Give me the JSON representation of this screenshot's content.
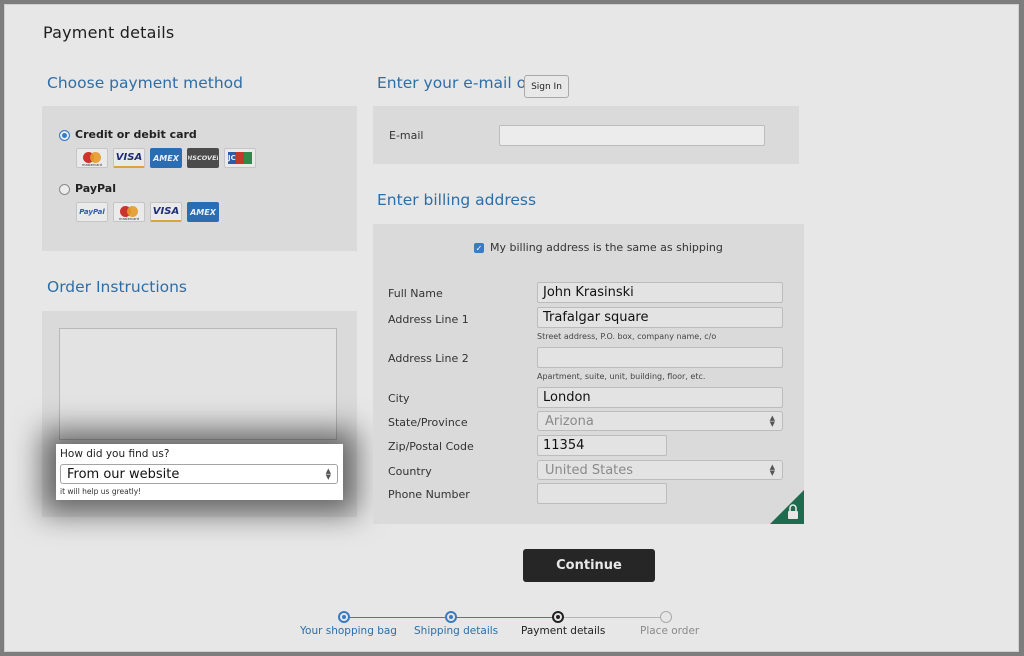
{
  "page": {
    "title": "Payment details"
  },
  "payment_method": {
    "heading": "Choose payment method",
    "options": [
      {
        "label": "Credit or debit card",
        "selected": true,
        "cards": [
          "mastercard",
          "VISA",
          "AMEX",
          "DISCOVER",
          "JCB"
        ]
      },
      {
        "label": "PayPal",
        "selected": false,
        "cards": [
          "PayPal",
          "mastercard",
          "VISA",
          "AMEX"
        ]
      }
    ],
    "mastercard_text": "mastercard",
    "visa_text": "VISA",
    "amex_text": "AMEX",
    "discover_text": "DISCOVER",
    "jcb_text": "JCB",
    "paypal_text": "PayPal"
  },
  "email": {
    "heading": "Enter your e-mail or",
    "sign_in": "Sign In",
    "label": "E-mail",
    "value": ""
  },
  "billing": {
    "heading": "Enter billing address",
    "same_as_shipping": "My billing address is the same as shipping",
    "same_checked": true,
    "fields": {
      "full_name": {
        "label": "Full Name",
        "value": "John Krasinski"
      },
      "address1": {
        "label": "Address Line 1",
        "value": "Trafalgar square",
        "hint": "Street address, P.O. box, company name, c/o"
      },
      "address2": {
        "label": "Address Line 2",
        "value": "",
        "hint": "Apartment, suite, unit, building, floor, etc."
      },
      "city": {
        "label": "City",
        "value": "London"
      },
      "state": {
        "label": "State/Province",
        "value": "Arizona"
      },
      "zip": {
        "label": "Zip/Postal Code",
        "value": "11354"
      },
      "country": {
        "label": "Country",
        "value": "United States"
      },
      "phone": {
        "label": "Phone Number",
        "value": ""
      }
    }
  },
  "order_instructions": {
    "heading": "Order Instructions",
    "value": ""
  },
  "survey": {
    "question": "How did you find us?",
    "selected": "From our website",
    "note": "it will help us greatly!"
  },
  "continue_label": "Continue",
  "steps": [
    {
      "label": "Your shopping bag",
      "state": "done"
    },
    {
      "label": "Shipping details",
      "state": "done"
    },
    {
      "label": "Payment details",
      "state": "current"
    },
    {
      "label": "Place order",
      "state": "upcoming"
    }
  ],
  "colors": {
    "accent": "#2e6ea7",
    "badge": "#1f6b4f"
  },
  "icons": {
    "lock": "lock-icon"
  }
}
